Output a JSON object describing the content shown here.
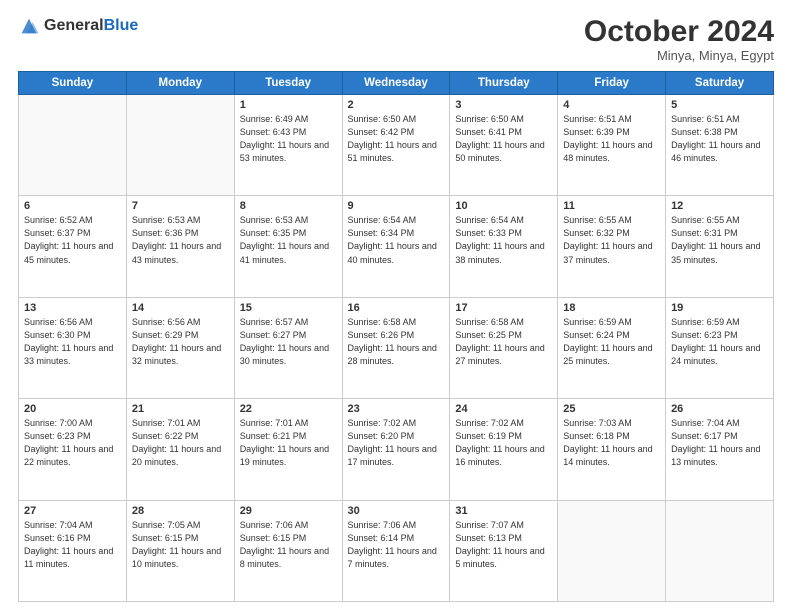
{
  "logo": {
    "line1": "General",
    "line2": "Blue"
  },
  "header": {
    "month": "October 2024",
    "location": "Minya, Minya, Egypt"
  },
  "weekdays": [
    "Sunday",
    "Monday",
    "Tuesday",
    "Wednesday",
    "Thursday",
    "Friday",
    "Saturday"
  ],
  "weeks": [
    [
      {
        "day": "",
        "info": ""
      },
      {
        "day": "",
        "info": ""
      },
      {
        "day": "1",
        "info": "Sunrise: 6:49 AM\nSunset: 6:43 PM\nDaylight: 11 hours and 53 minutes."
      },
      {
        "day": "2",
        "info": "Sunrise: 6:50 AM\nSunset: 6:42 PM\nDaylight: 11 hours and 51 minutes."
      },
      {
        "day": "3",
        "info": "Sunrise: 6:50 AM\nSunset: 6:41 PM\nDaylight: 11 hours and 50 minutes."
      },
      {
        "day": "4",
        "info": "Sunrise: 6:51 AM\nSunset: 6:39 PM\nDaylight: 11 hours and 48 minutes."
      },
      {
        "day": "5",
        "info": "Sunrise: 6:51 AM\nSunset: 6:38 PM\nDaylight: 11 hours and 46 minutes."
      }
    ],
    [
      {
        "day": "6",
        "info": "Sunrise: 6:52 AM\nSunset: 6:37 PM\nDaylight: 11 hours and 45 minutes."
      },
      {
        "day": "7",
        "info": "Sunrise: 6:53 AM\nSunset: 6:36 PM\nDaylight: 11 hours and 43 minutes."
      },
      {
        "day": "8",
        "info": "Sunrise: 6:53 AM\nSunset: 6:35 PM\nDaylight: 11 hours and 41 minutes."
      },
      {
        "day": "9",
        "info": "Sunrise: 6:54 AM\nSunset: 6:34 PM\nDaylight: 11 hours and 40 minutes."
      },
      {
        "day": "10",
        "info": "Sunrise: 6:54 AM\nSunset: 6:33 PM\nDaylight: 11 hours and 38 minutes."
      },
      {
        "day": "11",
        "info": "Sunrise: 6:55 AM\nSunset: 6:32 PM\nDaylight: 11 hours and 37 minutes."
      },
      {
        "day": "12",
        "info": "Sunrise: 6:55 AM\nSunset: 6:31 PM\nDaylight: 11 hours and 35 minutes."
      }
    ],
    [
      {
        "day": "13",
        "info": "Sunrise: 6:56 AM\nSunset: 6:30 PM\nDaylight: 11 hours and 33 minutes."
      },
      {
        "day": "14",
        "info": "Sunrise: 6:56 AM\nSunset: 6:29 PM\nDaylight: 11 hours and 32 minutes."
      },
      {
        "day": "15",
        "info": "Sunrise: 6:57 AM\nSunset: 6:27 PM\nDaylight: 11 hours and 30 minutes."
      },
      {
        "day": "16",
        "info": "Sunrise: 6:58 AM\nSunset: 6:26 PM\nDaylight: 11 hours and 28 minutes."
      },
      {
        "day": "17",
        "info": "Sunrise: 6:58 AM\nSunset: 6:25 PM\nDaylight: 11 hours and 27 minutes."
      },
      {
        "day": "18",
        "info": "Sunrise: 6:59 AM\nSunset: 6:24 PM\nDaylight: 11 hours and 25 minutes."
      },
      {
        "day": "19",
        "info": "Sunrise: 6:59 AM\nSunset: 6:23 PM\nDaylight: 11 hours and 24 minutes."
      }
    ],
    [
      {
        "day": "20",
        "info": "Sunrise: 7:00 AM\nSunset: 6:23 PM\nDaylight: 11 hours and 22 minutes."
      },
      {
        "day": "21",
        "info": "Sunrise: 7:01 AM\nSunset: 6:22 PM\nDaylight: 11 hours and 20 minutes."
      },
      {
        "day": "22",
        "info": "Sunrise: 7:01 AM\nSunset: 6:21 PM\nDaylight: 11 hours and 19 minutes."
      },
      {
        "day": "23",
        "info": "Sunrise: 7:02 AM\nSunset: 6:20 PM\nDaylight: 11 hours and 17 minutes."
      },
      {
        "day": "24",
        "info": "Sunrise: 7:02 AM\nSunset: 6:19 PM\nDaylight: 11 hours and 16 minutes."
      },
      {
        "day": "25",
        "info": "Sunrise: 7:03 AM\nSunset: 6:18 PM\nDaylight: 11 hours and 14 minutes."
      },
      {
        "day": "26",
        "info": "Sunrise: 7:04 AM\nSunset: 6:17 PM\nDaylight: 11 hours and 13 minutes."
      }
    ],
    [
      {
        "day": "27",
        "info": "Sunrise: 7:04 AM\nSunset: 6:16 PM\nDaylight: 11 hours and 11 minutes."
      },
      {
        "day": "28",
        "info": "Sunrise: 7:05 AM\nSunset: 6:15 PM\nDaylight: 11 hours and 10 minutes."
      },
      {
        "day": "29",
        "info": "Sunrise: 7:06 AM\nSunset: 6:15 PM\nDaylight: 11 hours and 8 minutes."
      },
      {
        "day": "30",
        "info": "Sunrise: 7:06 AM\nSunset: 6:14 PM\nDaylight: 11 hours and 7 minutes."
      },
      {
        "day": "31",
        "info": "Sunrise: 7:07 AM\nSunset: 6:13 PM\nDaylight: 11 hours and 5 minutes."
      },
      {
        "day": "",
        "info": ""
      },
      {
        "day": "",
        "info": ""
      }
    ]
  ]
}
